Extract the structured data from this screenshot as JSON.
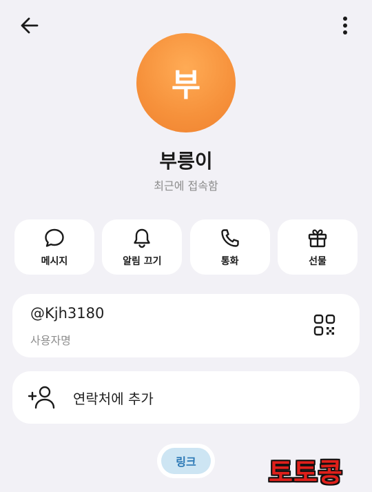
{
  "header": {
    "back_icon": "arrow-left-icon",
    "more_icon": "more-vertical-icon"
  },
  "profile": {
    "avatar_initial": "부",
    "avatar_color": "#f6913b",
    "name": "부릉이",
    "status": "최근에 접속함"
  },
  "actions": [
    {
      "label": "메시지",
      "icon": "chat-bubble-icon"
    },
    {
      "label": "알림 끄기",
      "icon": "bell-icon"
    },
    {
      "label": "통화",
      "icon": "phone-icon"
    },
    {
      "label": "선물",
      "icon": "gift-icon"
    }
  ],
  "username_card": {
    "value": "@Kjh3180",
    "label": "사용자명",
    "icon": "qr-code-icon"
  },
  "contact_card": {
    "label": "연락처에 추가",
    "icon": "add-contact-icon"
  },
  "link_chip": {
    "label": "링크",
    "color": "#2b78b5",
    "background": "#cde5f3"
  },
  "watermark": {
    "text": "토토콩",
    "color": "#e0201b"
  }
}
